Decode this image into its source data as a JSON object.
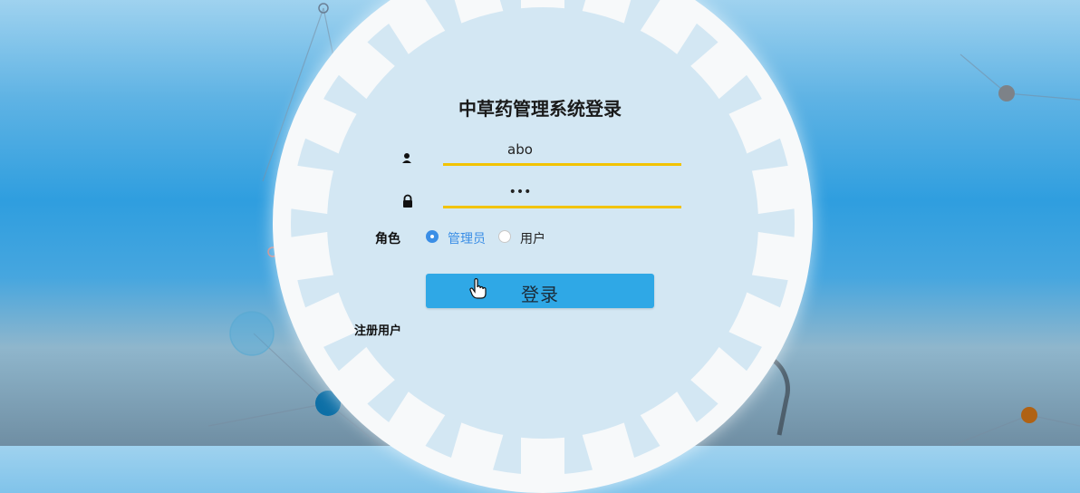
{
  "title": "中草药管理系统登录",
  "form": {
    "username_value": "abo",
    "password_value": "•••",
    "role_label": "角色",
    "roles": [
      {
        "label": "管理员",
        "selected": true
      },
      {
        "label": "用户",
        "selected": false
      }
    ],
    "login_label": "登录",
    "register_label": "注册用户"
  },
  "icons": {
    "username": "user-icon",
    "password": "lock-icon",
    "cursor": "hand-pointer-icon"
  },
  "colors": {
    "accent": "#2fa8e6",
    "underline": "#f2c300",
    "radio_selected": "#3a8ee6"
  }
}
